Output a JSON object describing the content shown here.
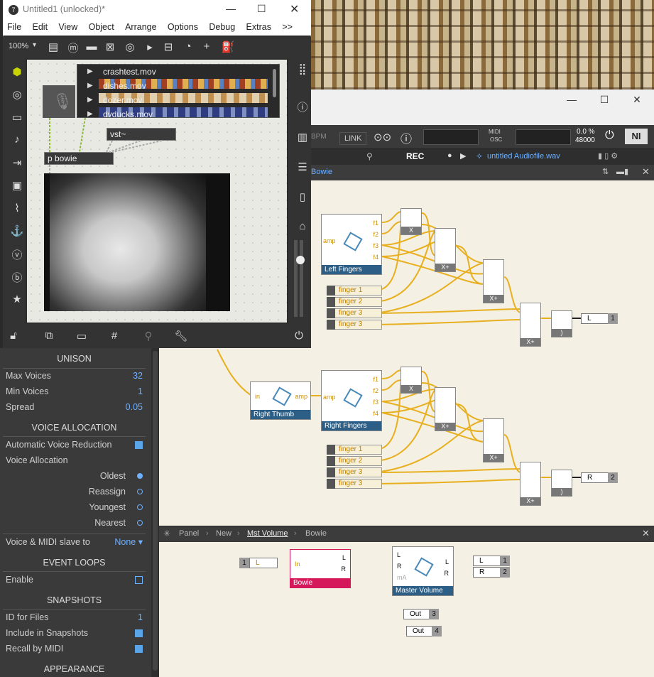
{
  "max": {
    "title": "Untitled1 (unlocked)*",
    "menu": [
      "File",
      "Edit",
      "View",
      "Object",
      "Arrange",
      "Options",
      "Debug",
      "Extras",
      ">>"
    ],
    "zoom": "100%",
    "files": [
      "crashtest.mov",
      "dishes.mov",
      "dozer.mov",
      "dvducks.mov"
    ],
    "vst_label": "vst~",
    "pbowie_label": "p bowie"
  },
  "reaktor": {
    "bpm_label": "BPM",
    "link_label": "LINK",
    "midi_label": "MIDI",
    "osc_label": "OSC",
    "cpu": "0.0 %",
    "rate": "48000",
    "rec_label": "REC",
    "audio_file": "untitled Audiofile.wav",
    "tab_name": "Bowie",
    "lower_breadcrumb": [
      "Panel",
      "New",
      "Mst Volume",
      "Bowie"
    ],
    "modules": {
      "left_fingers": "Left Fingers",
      "right_fingers": "Right Fingers",
      "right_thumb": "Right Thumb",
      "bowie": "Bowie",
      "master_volume": "Master Volume"
    },
    "fingers_upper": [
      "finger 1",
      "finger 2",
      "finger 3",
      "finger 3"
    ],
    "fingers_lower": [
      "finger 1",
      "finger 2",
      "finger 3",
      "finger 3"
    ],
    "ports_f": [
      "f1",
      "f2",
      "f3",
      "f4"
    ],
    "amp": "amp",
    "in": "In",
    "in_lower": "in",
    "mA": "mA",
    "out_L": "L",
    "out_L_num": "1",
    "out_R": "R",
    "out_R_num": "2",
    "out3": "Out",
    "out3_num": "3",
    "out4": "Out",
    "out4_num": "4",
    "in_L": "L",
    "in_L_num": "1",
    "mult": "X",
    "xplus": "X+",
    "rangle": ")"
  },
  "side": {
    "unison": "UNISON",
    "max_voices_label": "Max Voices",
    "max_voices": "32",
    "min_voices_label": "Min Voices",
    "min_voices": "1",
    "spread_label": "Spread",
    "spread": "0.05",
    "voice_alloc_title": "VOICE ALLOCATION",
    "auto_reduction": "Automatic Voice Reduction",
    "voice_alloc_label": "Voice Allocation",
    "oldest": "Oldest",
    "reassign": "Reassign",
    "youngest": "Youngest",
    "nearest": "Nearest",
    "slave_label": "Voice & MIDI slave to",
    "slave_value": "None ▾",
    "event_loops": "EVENT LOOPS",
    "enable": "Enable",
    "snapshots": "SNAPSHOTS",
    "id_files_label": "ID for Files",
    "id_files": "1",
    "include_snap": "Include in Snapshots",
    "recall_midi": "Recall by MIDI",
    "appearance": "APPEARANCE"
  },
  "colors": {
    "wire": "#e8b020",
    "accent_blue": "#2d5f86",
    "bowie_red": "#d4185a",
    "side_value": "#6fb0ff"
  }
}
